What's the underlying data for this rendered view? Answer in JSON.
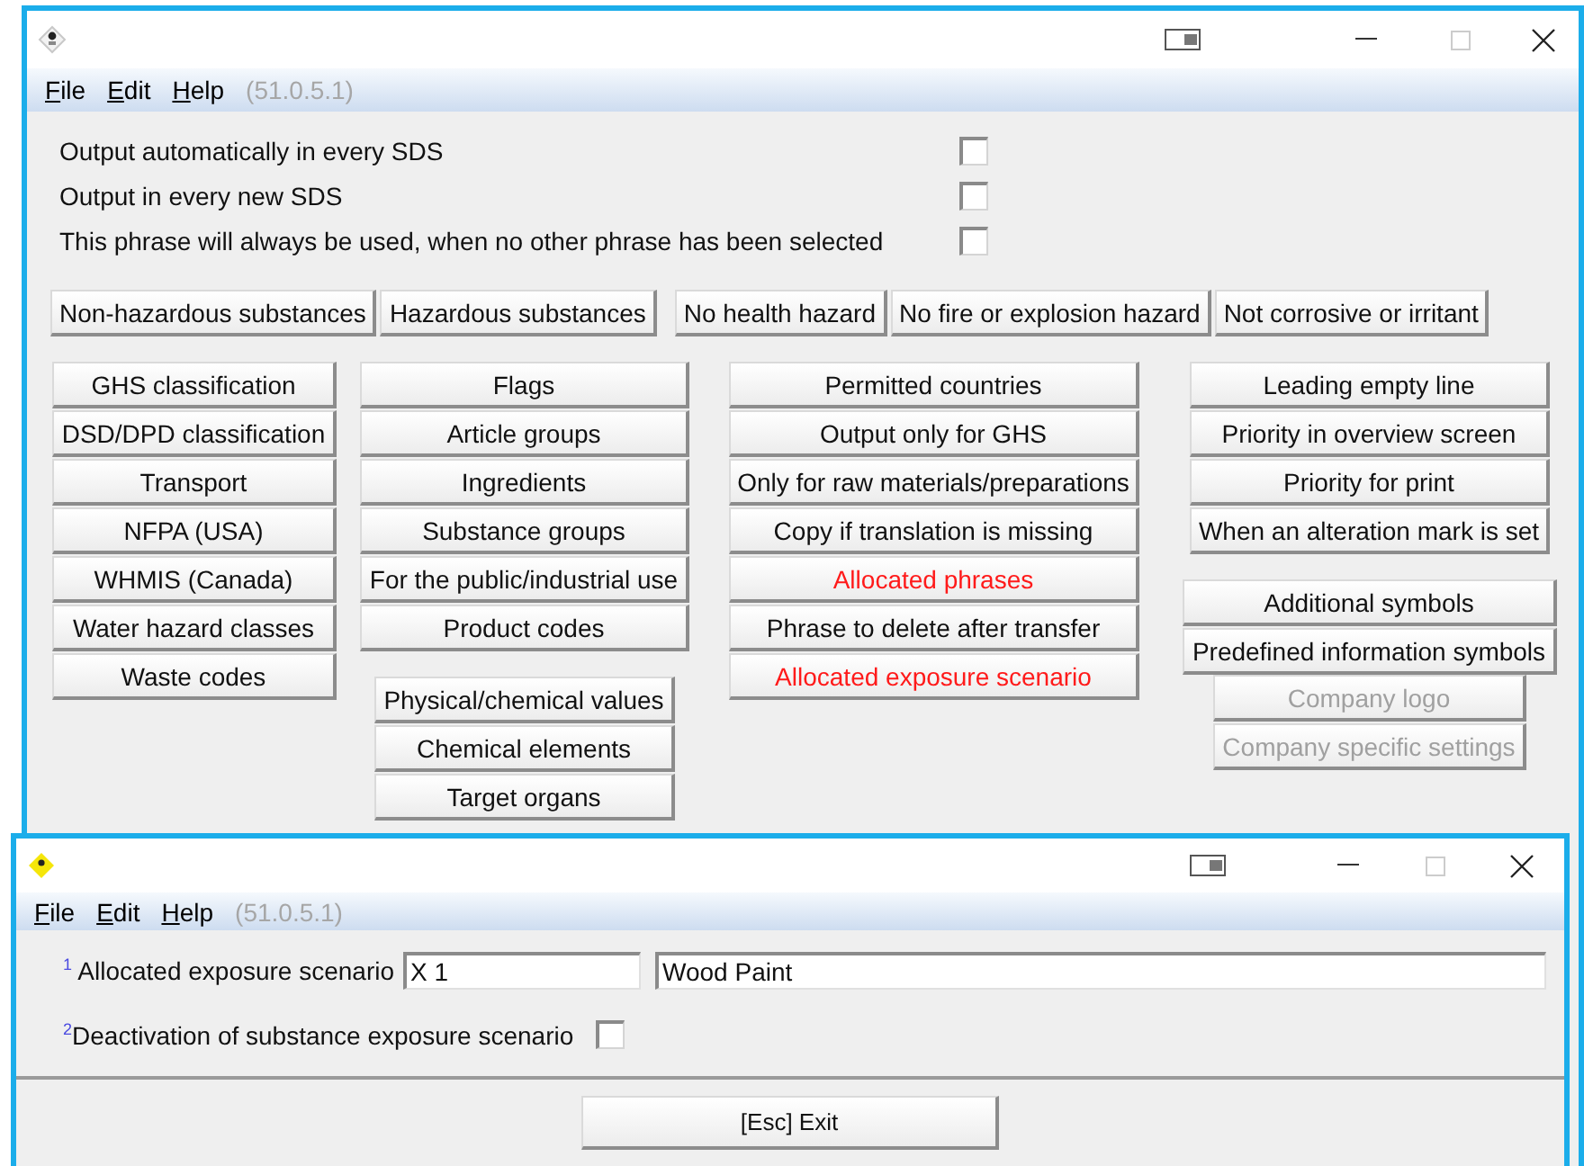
{
  "main_window": {
    "menu": [
      "File",
      "Edit",
      "Help"
    ],
    "version": "(51.0.5.1)",
    "options": [
      {
        "label": "Output automatically in every SDS",
        "checked": false
      },
      {
        "label": "Output in every new SDS",
        "checked": false
      },
      {
        "label": "This phrase will always be used, when no other phrase has been selected",
        "checked": false
      }
    ],
    "hazard_groups": [
      [
        "Non-hazardous substances",
        "Hazardous substances"
      ],
      [
        "No health hazard",
        "No fire or explosion hazard",
        "Not corrosive or irritant"
      ]
    ],
    "button_columns": [
      {
        "groups": [
          [
            {
              "label": "GHS classification",
              "kind": "normal"
            },
            {
              "label": "DSD/DPD classification",
              "kind": "normal"
            },
            {
              "label": "Transport",
              "kind": "normal"
            },
            {
              "label": "NFPA (USA)",
              "kind": "normal"
            },
            {
              "label": "WHMIS (Canada)",
              "kind": "normal"
            },
            {
              "label": "Water hazard classes",
              "kind": "normal"
            },
            {
              "label": "Waste codes",
              "kind": "normal"
            }
          ]
        ]
      },
      {
        "groups": [
          [
            {
              "label": "Flags",
              "kind": "normal"
            },
            {
              "label": "Article groups",
              "kind": "normal"
            },
            {
              "label": "Ingredients",
              "kind": "normal"
            },
            {
              "label": "Substance groups",
              "kind": "normal"
            },
            {
              "label": "For the public/industrial use",
              "kind": "normal"
            },
            {
              "label": "Product codes",
              "kind": "normal"
            }
          ],
          [
            {
              "label": "Physical/chemical values",
              "kind": "normal"
            },
            {
              "label": "Chemical elements",
              "kind": "normal"
            },
            {
              "label": "Target organs",
              "kind": "normal"
            }
          ]
        ]
      },
      {
        "groups": [
          [
            {
              "label": "Permitted countries",
              "kind": "normal"
            },
            {
              "label": "Output only for GHS",
              "kind": "normal"
            },
            {
              "label": "Only for raw materials/preparations",
              "kind": "normal"
            },
            {
              "label": "Copy if translation is missing",
              "kind": "normal"
            },
            {
              "label": "Allocated phrases",
              "kind": "alert"
            },
            {
              "label": "Phrase to delete after transfer",
              "kind": "normal"
            },
            {
              "label": "Allocated exposure scenario",
              "kind": "alert"
            }
          ]
        ]
      },
      {
        "groups": [
          [
            {
              "label": "Leading empty line",
              "kind": "normal"
            },
            {
              "label": "Priority in overview screen",
              "kind": "normal"
            },
            {
              "label": "Priority for print",
              "kind": "normal"
            },
            {
              "label": "When an alteration mark is set",
              "kind": "normal"
            }
          ],
          [
            {
              "label": "Additional symbols",
              "kind": "normal"
            },
            {
              "label": "Predefined information symbols",
              "kind": "normal"
            }
          ],
          [
            {
              "label": "Company logo",
              "kind": "disabled"
            },
            {
              "label": "Company specific settings",
              "kind": "disabled"
            }
          ]
        ]
      }
    ]
  },
  "detail_window": {
    "menu": [
      "File",
      "Edit",
      "Help"
    ],
    "version": "(51.0.5.1)",
    "scenario": {
      "label": "$^{1}$ Allocated exposure scenario",
      "code": "X 1",
      "name": "Wood Paint"
    },
    "deactivation": {
      "label": "$^{2}$Deactivation of substance exposure scenario",
      "checked": false
    },
    "exit_button": "[Esc] Exit"
  }
}
